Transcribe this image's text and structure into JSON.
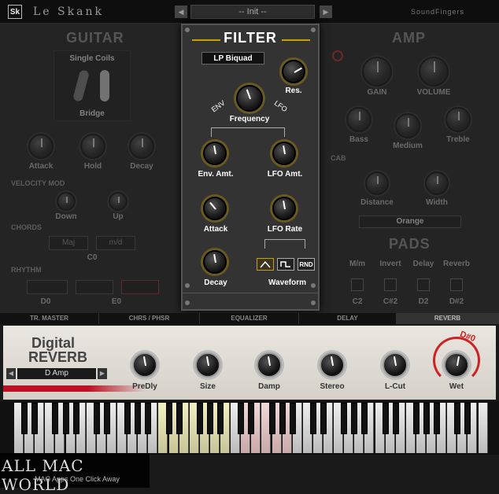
{
  "topbar": {
    "logo": "Sk",
    "app_name": "Le Skank",
    "preset": "-- Init --",
    "brand": "SoundFingers"
  },
  "guitar": {
    "title": "GUITAR",
    "pickup_type": "Single Coils",
    "pickup_position": "Bridge",
    "knobs": [
      "Attack",
      "Hold",
      "Decay"
    ],
    "velocity_title": "VELOCITY MOD",
    "velocity_knobs": [
      "Down",
      "Up"
    ],
    "chords_title": "CHORDS",
    "chord_buttons": [
      "Maj",
      "m/d"
    ],
    "chord_value": "C0",
    "rhythm_title": "RHYTHM",
    "rhythm_value_1": "D0",
    "rhythm_value_2": "E0"
  },
  "filter": {
    "title": "FILTER",
    "type": "LP Biquad",
    "res": "Res.",
    "env": "ENV",
    "lfo": "LFO",
    "frequency": "Frequency",
    "env_amt": "Env. Amt.",
    "lfo_amt": "LFO Amt.",
    "attack": "Attack",
    "lfo_rate": "LFO Rate",
    "decay": "Decay",
    "waveform": "Waveform",
    "wave_rnd": "RND"
  },
  "amp": {
    "title": "AMP",
    "knobs_row1": [
      "GAIN",
      "VOLUME"
    ],
    "knobs_row2": [
      "Bass",
      "Medium",
      "Treble"
    ],
    "cab_title": "CAB",
    "cab_knobs": [
      "Distance",
      "Width"
    ],
    "cab_value": "Orange"
  },
  "pads": {
    "title": "PADS",
    "headers": [
      "M/m",
      "Invert",
      "Delay",
      "Reverb"
    ],
    "notes": [
      "C2",
      "C#2",
      "D2",
      "D#2"
    ]
  },
  "fx_tabs": [
    "TR. MASTER",
    "CHRS / PHSR",
    "EQUALIZER",
    "DELAY",
    "REVERB"
  ],
  "reverb": {
    "title_1": "Digital",
    "title_2": "REVERB",
    "preset": "D Amp",
    "knobs": [
      "PreDly",
      "Size",
      "Damp",
      "Stereo",
      "L-Cut",
      "Wet"
    ],
    "indicator": "D#0"
  },
  "watermark": {
    "line1": "ALL MAC WORLD",
    "line2": "MAC Apps One Click Away"
  }
}
